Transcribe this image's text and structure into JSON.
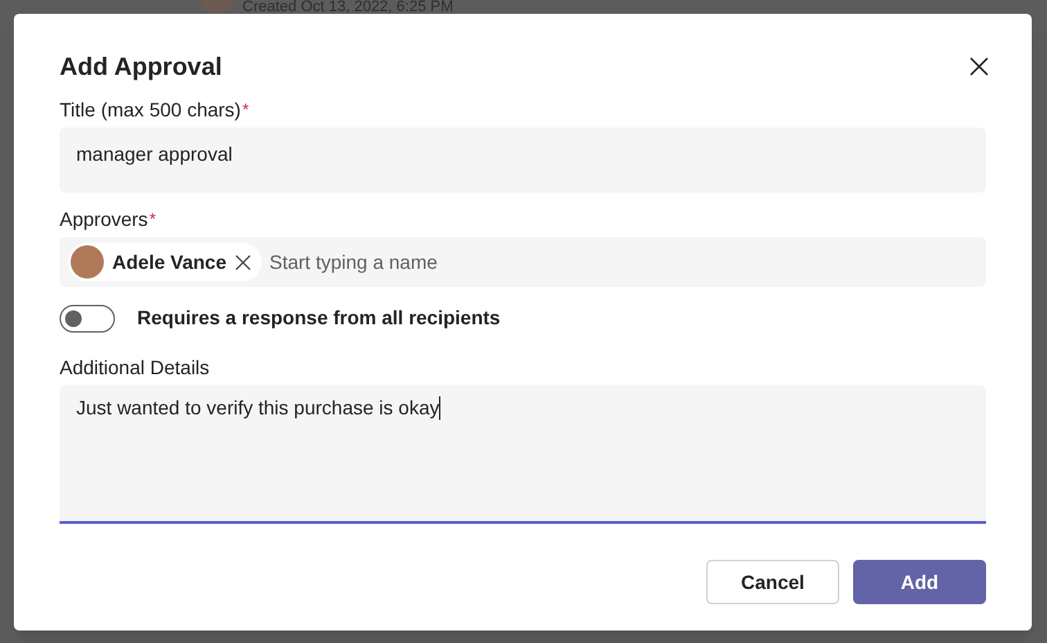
{
  "background": {
    "created": "Created Oct 13, 2022, 6:25 PM"
  },
  "dialog": {
    "title": "Add Approval",
    "title_field": {
      "label": "Title (max 500 chars)",
      "required_mark": "*",
      "value": "manager approval"
    },
    "approvers_field": {
      "label": "Approvers",
      "required_mark": "*",
      "chips": [
        {
          "name": "Adele Vance"
        }
      ],
      "placeholder": "Start typing a name"
    },
    "all_responses_toggle": {
      "label": "Requires a response from all recipients",
      "on": false
    },
    "details_field": {
      "label": "Additional Details",
      "value": "Just wanted to verify this purchase is okay",
      "focused": true
    },
    "buttons": [
      {
        "label": "Cancel",
        "kind": "secondary"
      },
      {
        "label": "Add",
        "kind": "primary"
      }
    ]
  }
}
